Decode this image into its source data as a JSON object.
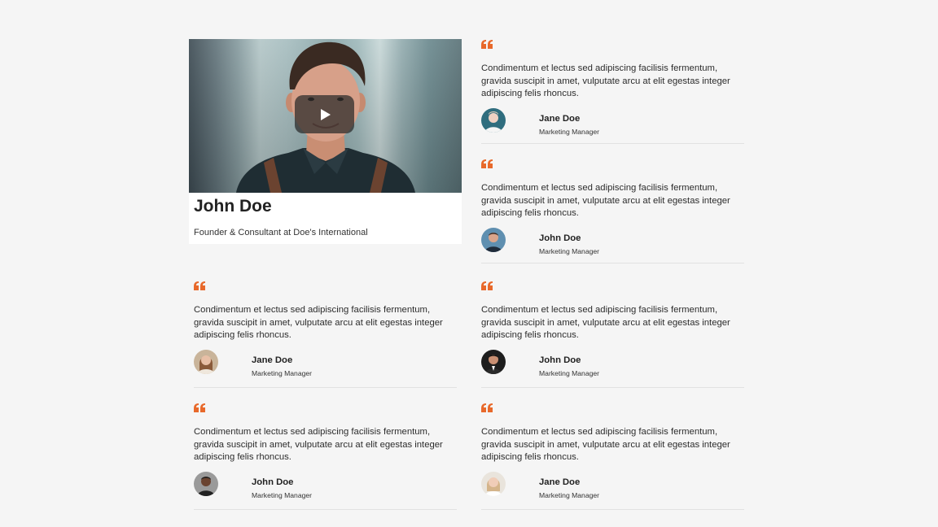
{
  "featured": {
    "name": "John Doe",
    "role": "Founder & Consultant at Doe's International",
    "play_icon": "play-icon"
  },
  "quote_icon": "quote-icon",
  "accent_color": "#e8692b",
  "testimonials": [
    {
      "text": "Condimentum et lectus sed adipiscing facilisis fermentum, gravida suscipit in amet, vulputate arcu at elit egestas integer adipiscing felis rhoncus.",
      "name": "Jane Doe",
      "role": "Marketing Manager"
    },
    {
      "text": "Condimentum et lectus sed adipiscing facilisis fermentum, gravida suscipit in amet, vulputate arcu at elit egestas integer adipiscing felis rhoncus.",
      "name": "John Doe",
      "role": "Marketing Manager"
    },
    {
      "text": "Condimentum et lectus sed adipiscing facilisis fermentum, gravida suscipit in amet, vulputate arcu at elit egestas integer adipiscing felis rhoncus.",
      "name": "Jane Doe",
      "role": "Marketing Manager"
    },
    {
      "text": "Condimentum et lectus sed adipiscing facilisis fermentum, gravida suscipit in amet, vulputate arcu at elit egestas integer adipiscing felis rhoncus.",
      "name": "John Doe",
      "role": "Marketing Manager"
    },
    {
      "text": "Condimentum et lectus sed adipiscing facilisis fermentum, gravida suscipit in amet, vulputate arcu at elit egestas integer adipiscing felis rhoncus.",
      "name": "John Doe",
      "role": "Marketing Manager"
    },
    {
      "text": "Condimentum et lectus sed adipiscing facilisis fermentum, gravida suscipit in amet, vulputate arcu at elit egestas integer adipiscing felis rhoncus.",
      "name": "Jane Doe",
      "role": "Marketing Manager"
    }
  ]
}
